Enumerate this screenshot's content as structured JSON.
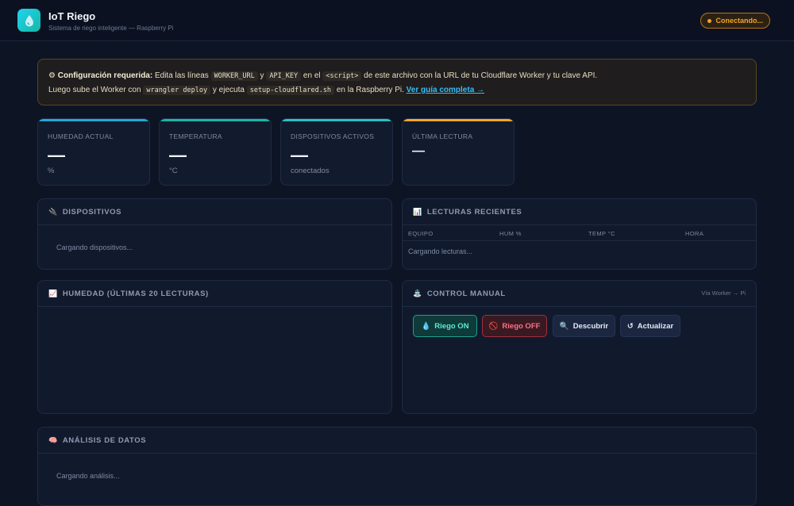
{
  "header": {
    "title": "IoT Riego",
    "subtitle": "Sistema de riego inteligente — Raspberry Pi",
    "status": "Conectando..."
  },
  "banner": {
    "icon": "⚙",
    "lead": "Configuración requerida:",
    "t1": " Edita las líneas ",
    "code1": "WORKER_URL",
    "t2": " y ",
    "code2": "API_KEY",
    "t3": " en el ",
    "code3": "<script>",
    "t4": " de este archivo con la URL de tu Cloudflare Worker y tu clave API.",
    "t5": "Luego sube el Worker con ",
    "code4": "wrangler deploy",
    "t6": " y ejecuta ",
    "code5": "setup-cloudflared.sh",
    "t7": " en la Raspberry Pi. ",
    "link": "Ver guía completa →"
  },
  "stats": [
    {
      "label": "Humedad actual",
      "value": "—",
      "unit": "%",
      "accent": "#22a7d8"
    },
    {
      "label": "Temperatura",
      "value": "—",
      "unit": "°C",
      "accent": "#14b8a6"
    },
    {
      "label": "Dispositivos activos",
      "value": "—",
      "unit": "conectados",
      "accent": "#22c4c4"
    },
    {
      "label": "Última lectura",
      "value": "—",
      "unit": "",
      "accent": "#f5a524"
    }
  ],
  "devices": {
    "icon": "🔌",
    "title": "Dispositivos",
    "loading": "Cargando dispositivos..."
  },
  "readings": {
    "icon": "📊",
    "title": "Lecturas recientes",
    "columns": [
      "EQUIPO",
      "HUM %",
      "TEMP °C",
      "HORA"
    ],
    "loading": "Cargando lecturas..."
  },
  "humidity_chart": {
    "icon": "📈",
    "title": "Humedad (últimas 20 lecturas)"
  },
  "control": {
    "icon": "⛲",
    "title": "Control manual",
    "via": "Vía Worker → Pi",
    "buttons": {
      "on": {
        "icon": "💧",
        "label": "Riego ON"
      },
      "off": {
        "icon": "🚫",
        "label": "Riego OFF"
      },
      "discover": {
        "icon": "🔍",
        "label": "Descubrir"
      },
      "refresh": {
        "icon": "↺",
        "label": "Actualizar"
      }
    }
  },
  "analysis": {
    "icon": "🧠",
    "title": "Análisis de datos",
    "loading": "Cargando análisis..."
  }
}
